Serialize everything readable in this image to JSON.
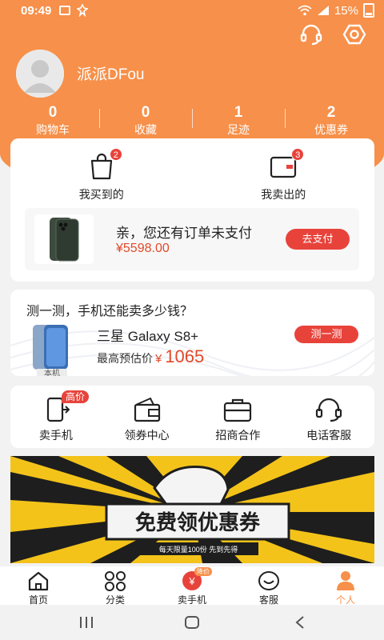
{
  "status_bar": {
    "time": "09:49",
    "battery": "15%"
  },
  "profile": {
    "username": "派派DFou"
  },
  "stats": [
    {
      "num": "0",
      "label": "购物车"
    },
    {
      "num": "0",
      "label": "收藏"
    },
    {
      "num": "1",
      "label": "足迹"
    },
    {
      "num": "2",
      "label": "优惠券"
    }
  ],
  "orders": {
    "bought": {
      "label": "我买到的",
      "badge": "2"
    },
    "sold": {
      "label": "我卖出的",
      "badge": "3"
    }
  },
  "pending": {
    "message": "亲，您还有订单未支付",
    "price": "¥5598.00",
    "pay_label": "去支付"
  },
  "estimate": {
    "question": "测一测，手机还能卖多少钱？",
    "device_tag": "本机",
    "device_name": "三星 Galaxy S8+",
    "price_label": "最高预估价",
    "currency": "¥",
    "price": "1065",
    "button": "测一测"
  },
  "services": [
    {
      "label": "卖手机",
      "badge": "高价"
    },
    {
      "label": "领券中心"
    },
    {
      "label": "招商合作"
    },
    {
      "label": "电话客服"
    }
  ],
  "banner": {
    "title": "免费领优惠券",
    "subtitle": "每天限量100份  先到先得"
  },
  "tabs": [
    {
      "label": "首页"
    },
    {
      "label": "分类"
    },
    {
      "label": "卖手机",
      "badge": "降价"
    },
    {
      "label": "客服"
    },
    {
      "label": "个人"
    }
  ],
  "colors": {
    "brand": "#f7904a",
    "accent": "#e8433b"
  }
}
